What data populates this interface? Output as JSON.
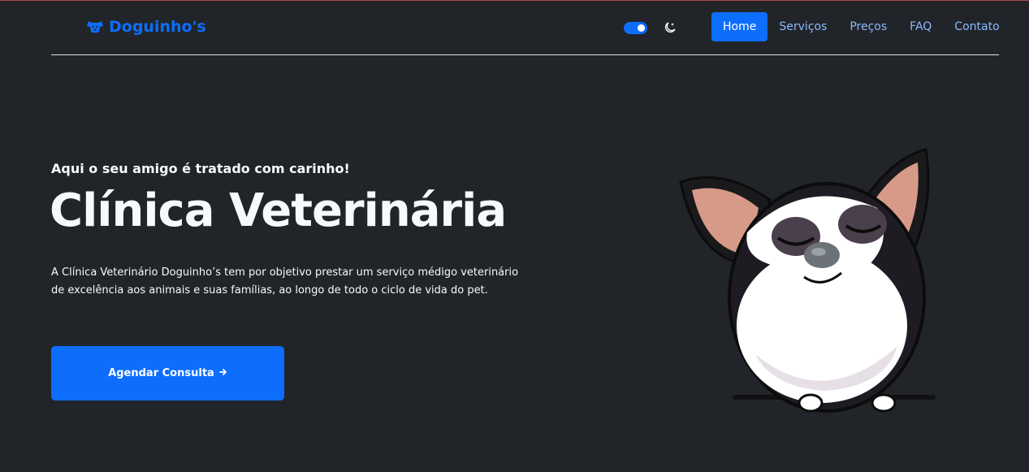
{
  "brand": {
    "name": "Doguinho's",
    "icon": "dog-paw-icon",
    "color": "#0d6efd"
  },
  "theme_toggle": {
    "enabled": true,
    "icon": "moon-stars-icon"
  },
  "nav": {
    "items": [
      {
        "label": "Home",
        "active": true
      },
      {
        "label": "Serviços",
        "active": false
      },
      {
        "label": "Preços",
        "active": false
      },
      {
        "label": "FAQ",
        "active": false
      },
      {
        "label": "Contato",
        "active": false
      }
    ]
  },
  "hero": {
    "subtitle": "Aqui o seu amigo é tratado com carinho!",
    "title": "Clínica Veterinária",
    "description": "A Clínica Veterinário Doguinho’s tem por objetivo prestar um serviço médigo veterinário de excelência aos animais e suas famílias, ao longo de todo o ciclo de vida do pet.",
    "cta_label": "Agendar Consulta",
    "cta_icon": "arrow-right-icon"
  },
  "colors": {
    "background": "#212529",
    "accent": "#0d6efd",
    "nav_link": "#8bb9fe"
  }
}
